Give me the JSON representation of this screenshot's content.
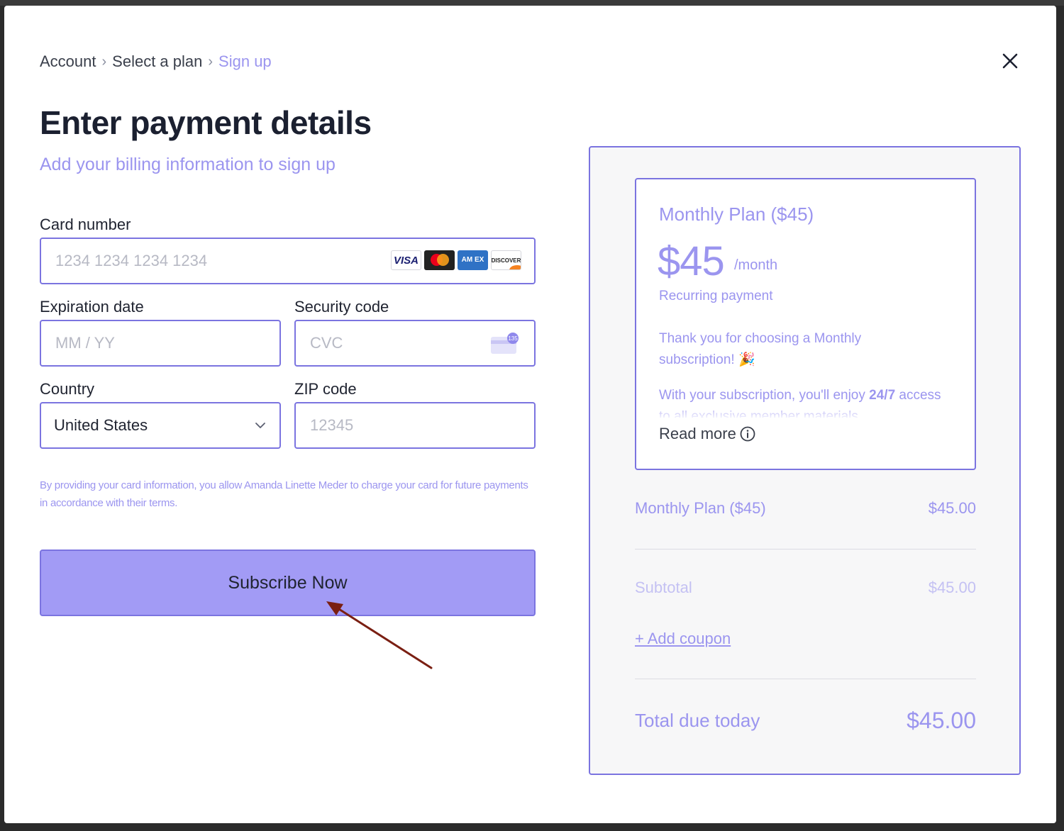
{
  "breadcrumb": {
    "items": [
      "Account",
      "Select a plan",
      "Sign up"
    ]
  },
  "header": {
    "title": "Enter payment details",
    "subtitle": "Add your billing information to sign up"
  },
  "form": {
    "card_number": {
      "label": "Card number",
      "placeholder": "1234 1234 1234 1234"
    },
    "card_brands": {
      "visa": "VISA",
      "amex": "AM EX",
      "discover": "DISCOVER"
    },
    "expiration": {
      "label": "Expiration date",
      "placeholder": "MM / YY"
    },
    "security": {
      "label": "Security code",
      "placeholder": "CVC",
      "icon_badge": "135"
    },
    "country": {
      "label": "Country",
      "value": "United States"
    },
    "zip": {
      "label": "ZIP code",
      "placeholder": "12345"
    },
    "legal": "By providing your card information, you allow Amanda Linette Meder to charge your card for future payments in accordance with their terms.",
    "submit_label": "Subscribe Now"
  },
  "summary": {
    "plan_name": "Monthly Plan ($45)",
    "price": "$45",
    "per": "/month",
    "recurring": "Recurring payment",
    "thanks": "Thank you for choosing a Monthly subscription! 🎉",
    "enjoy_prefix": "With your subscription, you'll enjoy ",
    "enjoy_bold": "24/7",
    "enjoy_suffix": " access to all exclusive member materials",
    "read_more": "Read more",
    "line_item": {
      "label": "Monthly Plan ($45)",
      "amount": "$45.00"
    },
    "subtotal": {
      "label": "Subtotal",
      "amount": "$45.00"
    },
    "coupon": "+ Add coupon",
    "total": {
      "label": "Total due today",
      "amount": "$45.00"
    }
  },
  "colors": {
    "accent": "#9b95ef",
    "border": "#7b74e0",
    "button": "#a29bf5",
    "annotation_arrow": "#7a1f12"
  },
  "icons": {
    "close": "close-icon",
    "separator": "chevron-right-icon",
    "dropdown": "chevron-down-icon",
    "info": "info-icon",
    "cvc": "cvc-card-icon",
    "annotation": "arrow-annotation-icon"
  }
}
